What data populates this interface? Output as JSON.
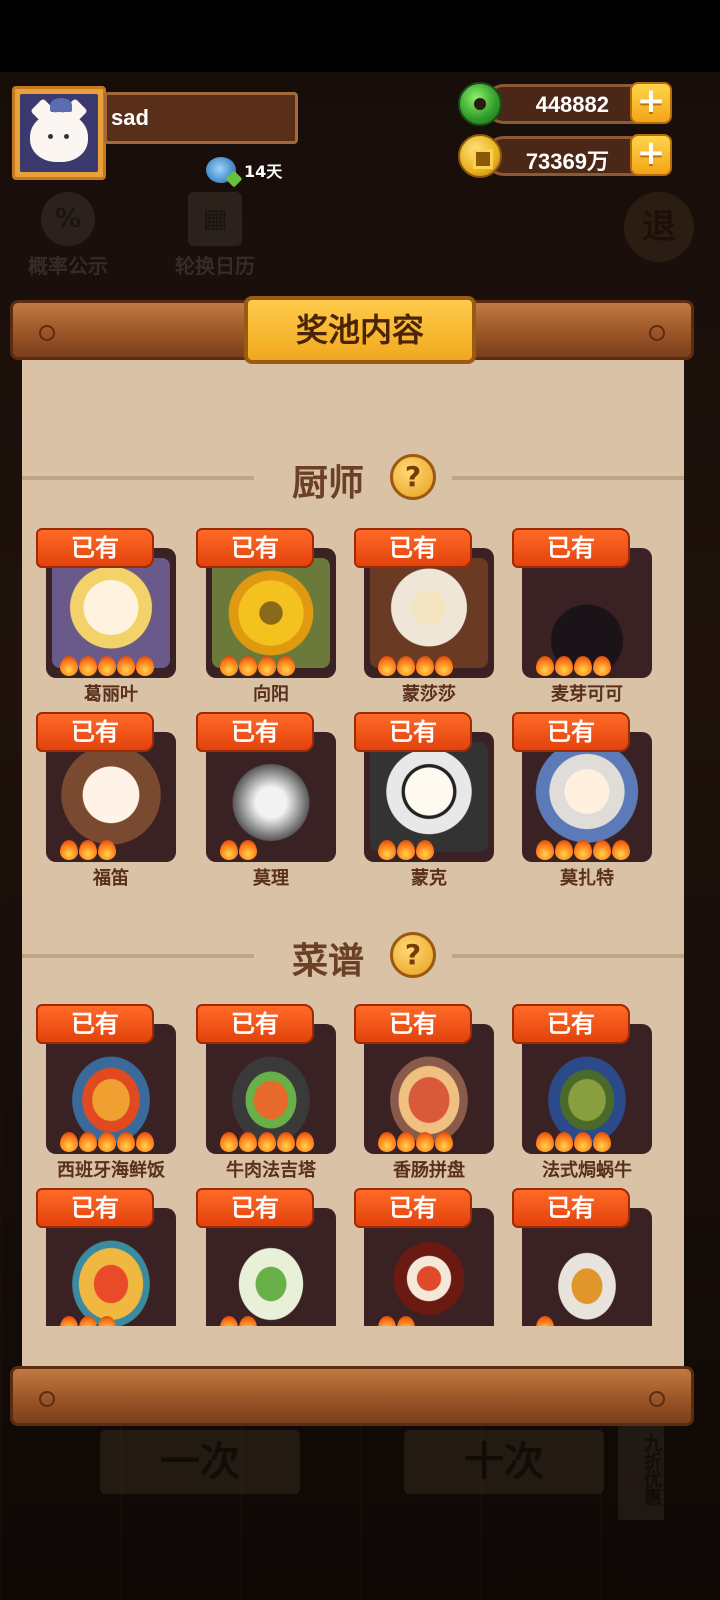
{
  "player": {
    "name": "sad",
    "streak_days": "14天"
  },
  "currencies": {
    "jade": "448882",
    "coins": "73369万"
  },
  "background_nav": {
    "probability": "概率公示",
    "calendar": "轮换日历",
    "exit": "退",
    "single_draw": "一次",
    "ten_draw": "十次",
    "discount": "九折优惠"
  },
  "panel": {
    "title": "奖池内容",
    "chef_section": "厨师",
    "recipe_section": "菜谱",
    "owned_label": "已有",
    "help_glyph": "?"
  },
  "chefs": [
    {
      "name": "葛丽叶",
      "stars": 5
    },
    {
      "name": "向阳",
      "stars": 4
    },
    {
      "name": "蒙莎莎",
      "stars": 4
    },
    {
      "name": "麦芽可可",
      "stars": 4
    },
    {
      "name": "福笛",
      "stars": 3
    },
    {
      "name": "莫理",
      "stars": 2
    },
    {
      "name": "蒙克",
      "stars": 3
    },
    {
      "name": "莫扎特",
      "stars": 5
    }
  ],
  "recipes": [
    {
      "name": "西班牙海鲜饭",
      "stars": 5
    },
    {
      "name": "牛肉法吉塔",
      "stars": 5
    },
    {
      "name": "香肠拼盘",
      "stars": 4
    },
    {
      "name": "法式焗蜗牛",
      "stars": 4
    },
    {
      "name": "",
      "stars": 3
    },
    {
      "name": "",
      "stars": 2
    },
    {
      "name": "",
      "stars": 2
    },
    {
      "name": "",
      "stars": 1
    }
  ],
  "colors": {
    "owned_badge": "#e2420c",
    "title_plaque": "#f0a81e",
    "panel": "#d9c2a6"
  }
}
